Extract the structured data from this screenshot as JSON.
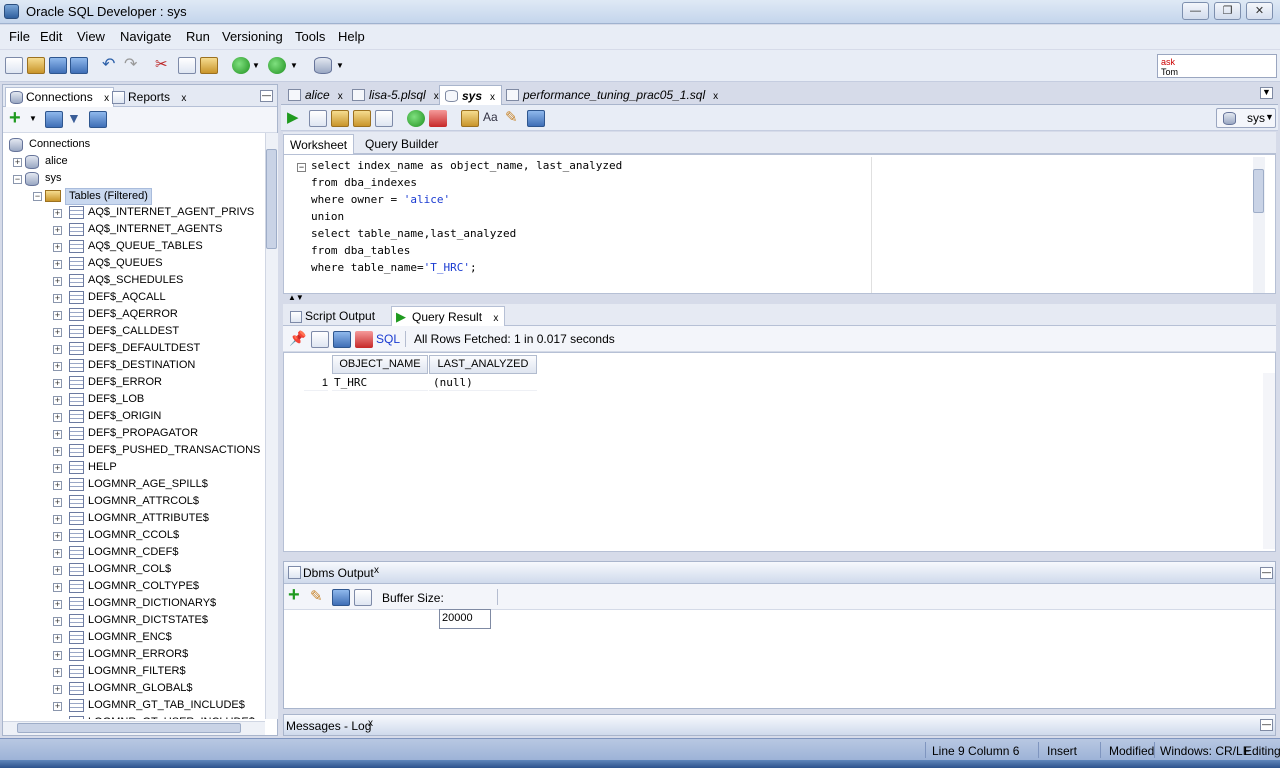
{
  "window": {
    "title": "Oracle SQL Developer : sys"
  },
  "menu": [
    {
      "label": "File"
    },
    {
      "label": "Edit"
    },
    {
      "label": "View"
    },
    {
      "label": "Navigate"
    },
    {
      "label": "Run"
    },
    {
      "label": "Versioning"
    },
    {
      "label": "Tools"
    },
    {
      "label": "Help"
    }
  ],
  "ask_box": {
    "line1": "ask",
    "line2": "Tom"
  },
  "left_panel": {
    "tabs": [
      {
        "label": "Connections",
        "active": true
      },
      {
        "label": "Reports",
        "active": false
      }
    ],
    "tree": {
      "root": "Connections",
      "connections": [
        "alice",
        "sys"
      ],
      "folder": "Tables (Filtered)",
      "tables": [
        "AQ$_INTERNET_AGENT_PRIVS",
        "AQ$_INTERNET_AGENTS",
        "AQ$_QUEUE_TABLES",
        "AQ$_QUEUES",
        "AQ$_SCHEDULES",
        "DEF$_AQCALL",
        "DEF$_AQERROR",
        "DEF$_CALLDEST",
        "DEF$_DEFAULTDEST",
        "DEF$_DESTINATION",
        "DEF$_ERROR",
        "DEF$_LOB",
        "DEF$_ORIGIN",
        "DEF$_PROPAGATOR",
        "DEF$_PUSHED_TRANSACTIONS",
        "HELP",
        "LOGMNR_AGE_SPILL$",
        "LOGMNR_ATTRCOL$",
        "LOGMNR_ATTRIBUTE$",
        "LOGMNR_CCOL$",
        "LOGMNR_CDEF$",
        "LOGMNR_COL$",
        "LOGMNR_COLTYPE$",
        "LOGMNR_DICTIONARY$",
        "LOGMNR_DICTSTATE$",
        "LOGMNR_ENC$",
        "LOGMNR_ERROR$",
        "LOGMNR_FILTER$",
        "LOGMNR_GLOBAL$",
        "LOGMNR_GT_TAB_INCLUDE$",
        "LOGMNR_GT_USER_INCLUDE$"
      ]
    }
  },
  "editor": {
    "tabs": [
      {
        "label": "alice",
        "active": false
      },
      {
        "label": "lisa-5.plsql",
        "active": false
      },
      {
        "label": "sys",
        "active": true
      },
      {
        "label": "performance_tuning_prac05_1.sql",
        "active": false
      }
    ],
    "connection": "sys",
    "worksheet_tabs": [
      {
        "label": "Worksheet",
        "active": true
      },
      {
        "label": "Query Builder",
        "active": false
      }
    ],
    "code_lines": [
      {
        "pre": "select index_name as object_name, last_analyzed",
        "str": "",
        "post": ""
      },
      {
        "pre": "from dba_indexes",
        "str": "",
        "post": ""
      },
      {
        "pre": "where owner = ",
        "str": "'alice'",
        "post": ""
      },
      {
        "pre": "union",
        "str": "",
        "post": ""
      },
      {
        "pre": "select table_name,last_analyzed",
        "str": "",
        "post": ""
      },
      {
        "pre": "from dba_tables",
        "str": "",
        "post": ""
      },
      {
        "pre": "where table_name=",
        "str": "'T_HRC'",
        "post": ";"
      }
    ]
  },
  "results": {
    "tabs": [
      {
        "label": "Script Output",
        "active": false
      },
      {
        "label": "Query Result",
        "active": true
      }
    ],
    "sql_link": "SQL",
    "status": "All Rows Fetched: 1 in 0.017 seconds",
    "columns": [
      "OBJECT_NAME",
      "LAST_ANALYZED"
    ],
    "rows": [
      {
        "num": "1",
        "cells": [
          "T_HRC",
          "(null)"
        ]
      }
    ]
  },
  "dbms": {
    "title": "Dbms Output",
    "buffer_label": "Buffer Size:",
    "buffer_value": "20000"
  },
  "messages": {
    "title": "Messages - Log"
  },
  "status_bar": {
    "position": "Line 9 Column 6",
    "mode": "Insert",
    "state": "Modified",
    "line_endings": "Windows: CR/LF",
    "edit": "Editing"
  }
}
